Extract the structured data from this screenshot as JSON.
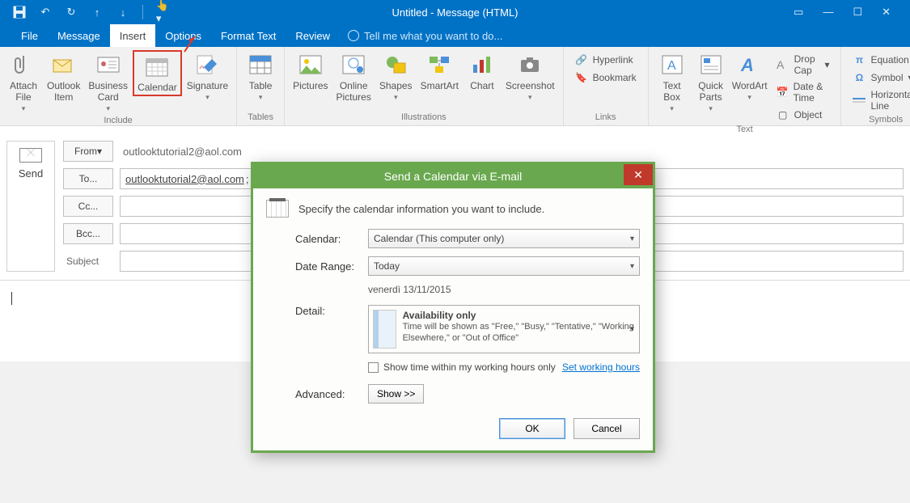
{
  "window": {
    "title": "Untitled - Message (HTML)"
  },
  "tabs": {
    "file": "File",
    "message": "Message",
    "insert": "Insert",
    "options": "Options",
    "format": "Format Text",
    "review": "Review",
    "tellme": "Tell me what you want to do..."
  },
  "ribbon": {
    "include": {
      "attach_file": "Attach\nFile",
      "outlook_item": "Outlook\nItem",
      "business_card": "Business\nCard",
      "calendar": "Calendar",
      "signature": "Signature",
      "label": "Include"
    },
    "tables": {
      "table": "Table",
      "label": "Tables"
    },
    "illustrations": {
      "pictures": "Pictures",
      "online_pictures": "Online\nPictures",
      "shapes": "Shapes",
      "smartart": "SmartArt",
      "chart": "Chart",
      "screenshot": "Screenshot",
      "label": "Illustrations"
    },
    "links": {
      "hyperlink": "Hyperlink",
      "bookmark": "Bookmark",
      "label": "Links"
    },
    "text": {
      "text_box": "Text\nBox",
      "quick_parts": "Quick\nParts",
      "wordart": "WordArt",
      "drop_cap": "Drop Cap",
      "date_time": "Date & Time",
      "object": "Object",
      "label": "Text"
    },
    "symbols": {
      "equation": "Equation",
      "symbol": "Symbol",
      "hline": "Horizontal Line",
      "label": "Symbols"
    }
  },
  "compose": {
    "send": "Send",
    "from": "From",
    "to": "To...",
    "cc": "Cc...",
    "bcc": "Bcc...",
    "subject": "Subject",
    "from_value": "outlooktutorial2@aol.com",
    "to_value": "outlooktutorial2@aol.com",
    "to_tail": "; c"
  },
  "dialog": {
    "title": "Send a Calendar via E-mail",
    "intro": "Specify the calendar information you want to include.",
    "calendar_label": "Calendar:",
    "calendar_value": "Calendar (This computer only)",
    "daterange_label": "Date Range:",
    "daterange_value": "Today",
    "date_display": "venerdì 13/11/2015",
    "detail_label": "Detail:",
    "detail_heading": "Availability only",
    "detail_sub": "Time will be shown as \"Free,\" \"Busy,\" \"Tentative,\" \"Working Elsewhere,\" or \"Out of Office\"",
    "working_hours_chk": "Show time within my working hours only",
    "set_working_hours": "Set working hours",
    "advanced_label": "Advanced:",
    "show_btn": "Show >>",
    "ok": "OK",
    "cancel": "Cancel"
  }
}
